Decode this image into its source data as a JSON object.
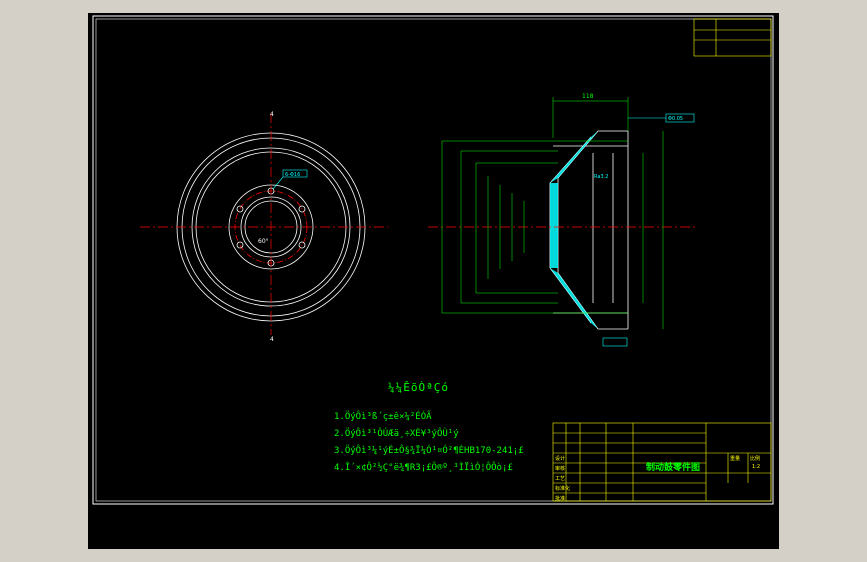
{
  "drawing": {
    "background": "#000000",
    "line_color": "#ffffff",
    "center_line_color": "#ff0000",
    "dimension_color": "#00ff00",
    "annotation_color": "#00ffff",
    "titleblock_color": "#ffff00"
  },
  "technical_requirements": {
    "title": "¼¼ÊõÒªÇó",
    "items": [
      "1.ÖýÔì³ß´ç±ê×¼²ÉÓÃ",
      "2.ÖýÔì³¹ÔÚÆä¸÷XÈ¥³ýÔÙ¹ý",
      "3.ÖýÔì³¼¹ýÉ±Ô§¾Ï¼Ó¹¤Ó²¶ÈHB170-241¡£",
      "4.Î´×¢Ô²½Ç°ë¾¶R3¡£Ö®º¸³ÌÏìÓ¦Ô­Ôò¡£"
    ]
  },
  "title_block": {
    "drawing_name": "制动鼓零件图",
    "scale": "1:2",
    "labels": [
      "设计",
      "审核",
      "工艺",
      "标准化",
      "批准",
      "重量",
      "比例"
    ]
  },
  "annotations": {
    "left_top_label": "4",
    "left_bottom_label": "4",
    "left_angle": "60°",
    "hole_note": "6-Φ16",
    "right_dim_top": "118",
    "right_dim_side": "Φ0.05",
    "roughness": "Ra3.2"
  }
}
